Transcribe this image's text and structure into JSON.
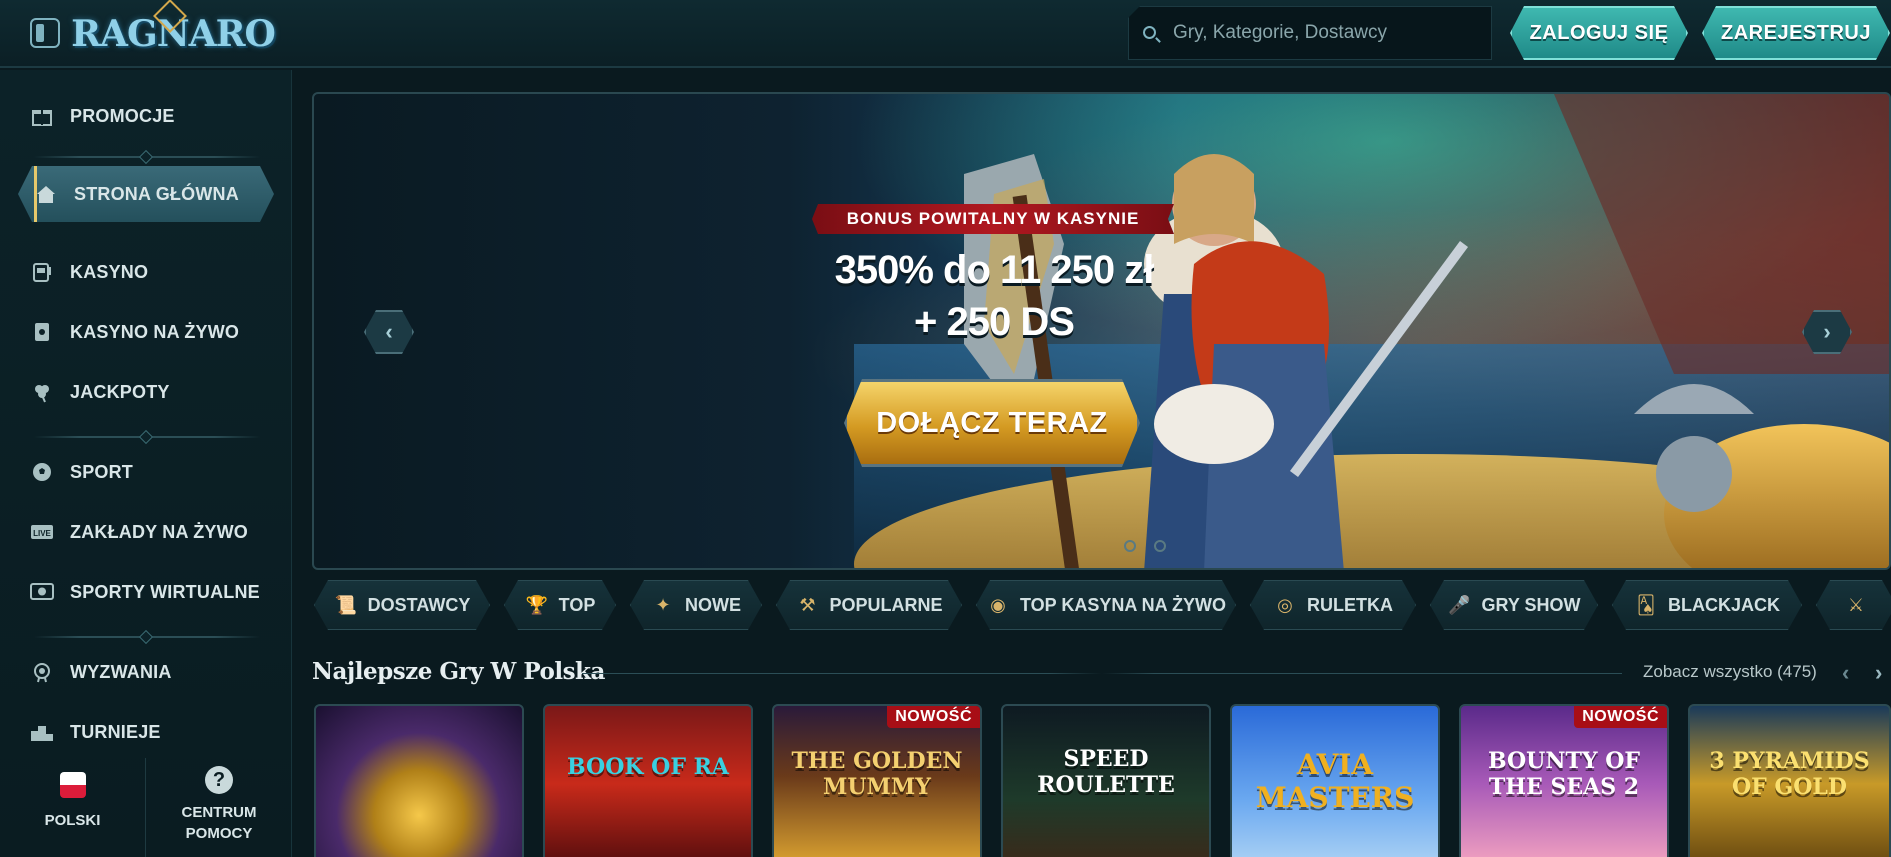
{
  "header": {
    "logo_text": "RAGNARO",
    "search_placeholder": "Gry, Kategorie, Dostawcy",
    "login_label": "ZALOGUJ SIĘ",
    "register_label": "ZAREJESTRUJ"
  },
  "sidebar": {
    "items": [
      {
        "label": "PROMOCJE",
        "icon": "gift-icon"
      },
      {
        "label": "STRONA GŁÓWNA",
        "icon": "home-icon",
        "active": true
      },
      {
        "label": "KASYNO",
        "icon": "slot-machine-icon"
      },
      {
        "label": "KASYNO NA ŻYWO",
        "icon": "live-card-icon"
      },
      {
        "label": "JACKPOTY",
        "icon": "clover-icon"
      },
      {
        "label": "SPORT",
        "icon": "soccer-ball-icon"
      },
      {
        "label": "ZAKŁADY NA ŻYWO",
        "icon": "live-badge-icon"
      },
      {
        "label": "SPORTY WIRTUALNE",
        "icon": "virtual-sport-icon"
      },
      {
        "label": "WYZWANIA",
        "icon": "medal-icon"
      },
      {
        "label": "TURNIEJE",
        "icon": "podium-icon"
      }
    ],
    "language_label": "POLSKI",
    "help_label": "CENTRUM POMOCY"
  },
  "hero": {
    "badge": "BONUS POWITALNY W KASYNIE",
    "line1": "350% do 11 250 zł",
    "line2": "+ 250 DS",
    "cta": "DOŁĄCZ TERAZ"
  },
  "categories": [
    {
      "label": "DOSTAWCY",
      "icon": "scroll-icon"
    },
    {
      "label": "TOP",
      "icon": "trophy-icon"
    },
    {
      "label": "NOWE",
      "icon": "new-icon"
    },
    {
      "label": "POPULARNE",
      "icon": "hammer-icon"
    },
    {
      "label": "TOP KASYNA NA ŻYWO",
      "icon": "chip-icon"
    },
    {
      "label": "RULETKA",
      "icon": "roulette-icon"
    },
    {
      "label": "GRY SHOW",
      "icon": "microphone-icon"
    },
    {
      "label": "BLACKJACK",
      "icon": "cards-icon"
    }
  ],
  "section": {
    "title": "Najlepsze Gry W Polska",
    "see_all": "Zobacz wszystko (475)"
  },
  "games": [
    {
      "name": "",
      "new": false
    },
    {
      "name": "BOOK OF RA",
      "new": false
    },
    {
      "name": "THE GOLDEN MUMMY",
      "new": true
    },
    {
      "name": "SPEED ROULETTE",
      "new": false
    },
    {
      "name": "AVIA MASTERS",
      "new": false
    },
    {
      "name": "BOUNTY OF THE SEAS 2",
      "new": true
    },
    {
      "name": "3 PYRAMIDS OF GOLD",
      "new": false
    }
  ],
  "labels": {
    "new_badge": "NOWOŚĆ"
  }
}
